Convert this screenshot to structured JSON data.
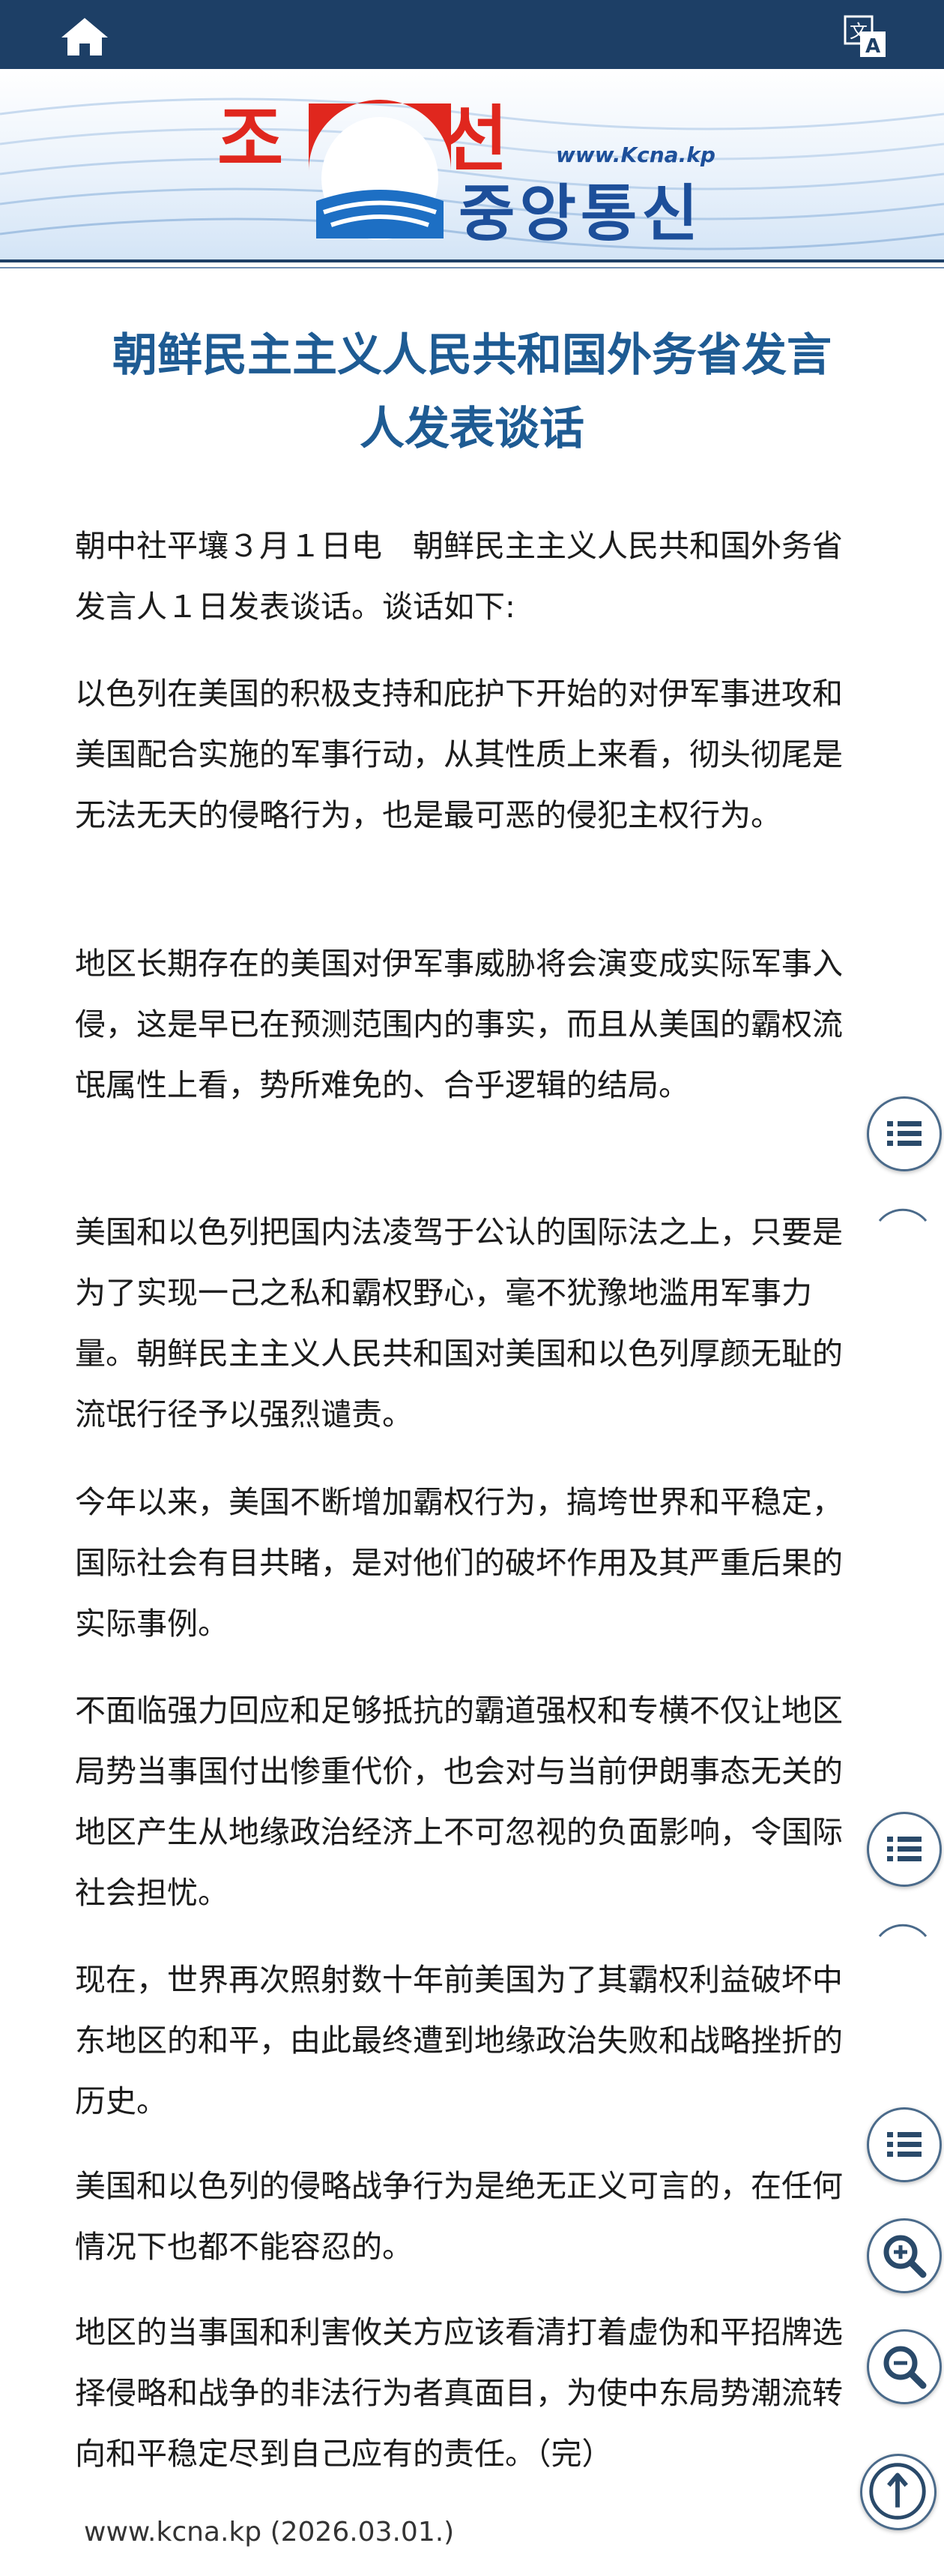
{
  "header": {
    "home_icon": "home-icon",
    "translate_icon": "translate-icon"
  },
  "banner": {
    "logo_word1": "조",
    "logo_word2": "선",
    "logo_word3": "중앙통신",
    "logo_url": "www.Kcna.kp"
  },
  "article": {
    "title_line1": "朝鲜民主主义人民共和国外务省发言",
    "title_line2": "人发表谈话",
    "paragraphs": [
      "朝中社平壤３月１日电　朝鲜民主主义人民共和国外务省发言人１日发表谈话。谈话如下:",
      "以色列在美国的积极支持和庇护下开始的对伊军事进攻和美国配合实施的军事行动，从其性质上来看，彻头彻尾是无法无天的侵略行为，也是最可恶的侵犯主权行为。",
      "地区长期存在的美国对伊军事威胁将会演变成实际军事入侵，这是早已在预测范围内的事实，而且从美国的霸权流氓属性上看，势所难免的、合乎逻辑的结局。",
      "美国和以色列把国内法凌驾于公认的国际法之上，只要是为了实现一己之私和霸权野心，毫不犹豫地滥用军事力量。朝鲜民主主义人民共和国对美国和以色列厚颜无耻的流氓行径予以强烈谴责。",
      "今年以来，美国不断增加霸权行为，搞垮世界和平稳定，国际社会有目共睹，是对他们的破坏作用及其严重后果的实际事例。",
      "不面临强力回应和足够抵抗的霸道强权和专横不仅让地区局势当事国付出惨重代价，也会对与当前伊朗事态无关的地区产生从地缘政治经济上不可忽视的负面影响，令国际社会担忧。",
      "现在，世界再次照射数十年前美国为了其霸权利益破坏中东地区的和平，由此最终遭到地缘政治失败和战略挫折的历史。",
      "美国和以色列的侵略战争行为是绝无正义可言的，在任何情况下也都不能容忍的。",
      "地区的当事国和利害攸关方应该看清打着虚伪和平招牌选择侵略和战争的非法行为者真面目，为使中东局势潮流转向和平稳定尽到自己应有的责任。（完）"
    ],
    "source": "www.kcna.kp (2026.03.01.)"
  },
  "floating": {
    "list_icon": "list-icon",
    "zoom_in_icon": "zoom-in-icon",
    "zoom_out_icon": "zoom-out-icon",
    "scroll_top_icon": "arrow-up-icon"
  },
  "colors": {
    "topbar": "#1d3f66",
    "title": "#1e5b93",
    "logo_red": "#e0271e",
    "logo_blue": "#1d4f9a"
  }
}
